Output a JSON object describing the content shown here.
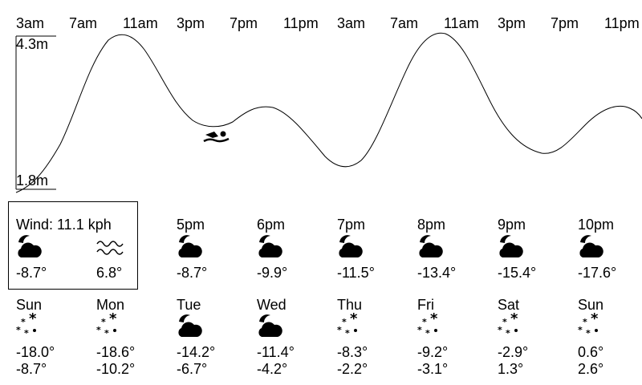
{
  "tide": {
    "hours": [
      "3am",
      "7am",
      "11am",
      "3pm",
      "7pm",
      "11pm",
      "3am",
      "7am",
      "11am",
      "3pm",
      "7pm",
      "11pm"
    ],
    "max_label": "4.3m",
    "min_label": "1.8m"
  },
  "current": {
    "wind": "Wind: 11.1 kph",
    "icon": "cloud-moon-icon",
    "temp": "-8.7°",
    "water_icon": "water-waves-icon",
    "water_temp": "6.8°"
  },
  "hourly": [
    {
      "time": "5pm",
      "icon": "cloud-moon-icon",
      "temp": "-8.7°"
    },
    {
      "time": "6pm",
      "icon": "cloud-moon-icon",
      "temp": "-9.9°"
    },
    {
      "time": "7pm",
      "icon": "cloud-moon-icon",
      "temp": "-11.5°"
    },
    {
      "time": "8pm",
      "icon": "cloud-moon-icon",
      "temp": "-13.4°"
    },
    {
      "time": "9pm",
      "icon": "cloud-moon-icon",
      "temp": "-15.4°"
    },
    {
      "time": "10pm",
      "icon": "cloud-moon-icon",
      "temp": "-17.6°"
    }
  ],
  "daily": [
    {
      "day": "Sun",
      "icon": "snow-icon",
      "low": "-18.0°",
      "high": "-8.7°"
    },
    {
      "day": "Mon",
      "icon": "snow-icon",
      "low": "-18.6°",
      "high": "-10.2°"
    },
    {
      "day": "Tue",
      "icon": "cloud-moon-icon",
      "low": "-14.2°",
      "high": "-6.7°"
    },
    {
      "day": "Wed",
      "icon": "cloud-moon-icon",
      "low": "-11.4°",
      "high": "-4.2°"
    },
    {
      "day": "Thu",
      "icon": "snow-icon",
      "low": "-8.3°",
      "high": "-2.2°"
    },
    {
      "day": "Fri",
      "icon": "snow-icon",
      "low": "-9.2°",
      "high": "-3.1°"
    },
    {
      "day": "Sat",
      "icon": "snow-icon",
      "low": "-2.9°",
      "high": "1.3°"
    },
    {
      "day": "Sun",
      "icon": "snow-icon",
      "low": "0.6°",
      "high": "2.6°"
    }
  ]
}
